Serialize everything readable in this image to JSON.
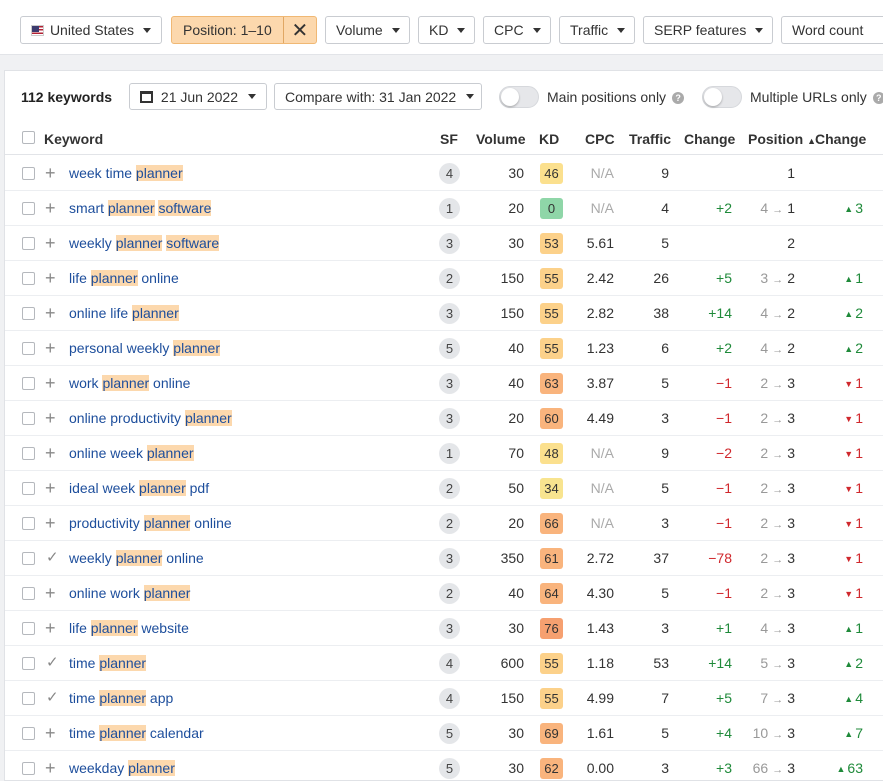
{
  "filters": {
    "country": "United States",
    "position": "Position: 1–10",
    "volume": "Volume",
    "kd": "KD",
    "cpc": "CPC",
    "traffic": "Traffic",
    "serp": "SERP features",
    "wordcount": "Word count"
  },
  "toolbar": {
    "count": "112 keywords",
    "date": "21 Jun 2022",
    "compare": "Compare with: 31 Jan 2022",
    "main_positions": "Main positions only",
    "multiple_urls": "Multiple URLs only"
  },
  "columns": {
    "keyword": "Keyword",
    "sf": "SF",
    "volume": "Volume",
    "kd": "KD",
    "cpc": "CPC",
    "traffic": "Traffic",
    "change": "Change",
    "position": "Position",
    "position_change": "Change"
  },
  "kd_colors": {
    "green": "#8fd6a8",
    "yellow": "#f8e48f",
    "yellowish": "#fbe08e",
    "lightorange": "#fcd18a",
    "orange": "#f9b47d",
    "orange2": "#f6a070"
  },
  "rows": [
    {
      "parts": [
        [
          "week time ",
          0
        ],
        [
          "planner",
          1
        ]
      ],
      "icon": "plus",
      "sf": "4",
      "volume": "30",
      "kd": "46",
      "cpc": "N/A",
      "traffic": "9",
      "change": "",
      "change_dir": "",
      "prev": "",
      "pos": "1",
      "pchange": "",
      "pdir": ""
    },
    {
      "parts": [
        [
          "smart ",
          0
        ],
        [
          "planner",
          1
        ],
        [
          " ",
          0
        ],
        [
          "software",
          1
        ]
      ],
      "icon": "plus",
      "sf": "1",
      "volume": "20",
      "kd": "0",
      "cpc": "N/A",
      "traffic": "4",
      "change": "+2",
      "change_dir": "up",
      "prev": "4",
      "pos": "1",
      "pchange": "3",
      "pdir": "up"
    },
    {
      "parts": [
        [
          "weekly ",
          0
        ],
        [
          "planner",
          1
        ],
        [
          " ",
          0
        ],
        [
          "software",
          1
        ]
      ],
      "icon": "plus",
      "sf": "3",
      "volume": "30",
      "kd": "53",
      "cpc": "5.61",
      "traffic": "5",
      "change": "",
      "change_dir": "",
      "prev": "",
      "pos": "2",
      "pchange": "",
      "pdir": ""
    },
    {
      "parts": [
        [
          "life ",
          0
        ],
        [
          "planner",
          1
        ],
        [
          " online",
          0
        ]
      ],
      "icon": "plus",
      "sf": "2",
      "volume": "150",
      "kd": "55",
      "cpc": "2.42",
      "traffic": "26",
      "change": "+5",
      "change_dir": "up",
      "prev": "3",
      "pos": "2",
      "pchange": "1",
      "pdir": "up"
    },
    {
      "parts": [
        [
          "online life ",
          0
        ],
        [
          "planner",
          1
        ]
      ],
      "icon": "plus",
      "sf": "3",
      "volume": "150",
      "kd": "55",
      "cpc": "2.82",
      "traffic": "38",
      "change": "+14",
      "change_dir": "up",
      "prev": "4",
      "pos": "2",
      "pchange": "2",
      "pdir": "up"
    },
    {
      "parts": [
        [
          "personal weekly ",
          0
        ],
        [
          "planner",
          1
        ]
      ],
      "icon": "plus",
      "sf": "5",
      "volume": "40",
      "kd": "55",
      "cpc": "1.23",
      "traffic": "6",
      "change": "+2",
      "change_dir": "up",
      "prev": "4",
      "pos": "2",
      "pchange": "2",
      "pdir": "up"
    },
    {
      "parts": [
        [
          "work ",
          0
        ],
        [
          "planner",
          1
        ],
        [
          " online",
          0
        ]
      ],
      "icon": "plus",
      "sf": "3",
      "volume": "40",
      "kd": "63",
      "cpc": "3.87",
      "traffic": "5",
      "change": "−1",
      "change_dir": "down",
      "prev": "2",
      "pos": "3",
      "pchange": "1",
      "pdir": "down"
    },
    {
      "parts": [
        [
          "online productivity ",
          0
        ],
        [
          "planner",
          1
        ]
      ],
      "icon": "plus",
      "sf": "3",
      "volume": "20",
      "kd": "60",
      "cpc": "4.49",
      "traffic": "3",
      "change": "−1",
      "change_dir": "down",
      "prev": "2",
      "pos": "3",
      "pchange": "1",
      "pdir": "down"
    },
    {
      "parts": [
        [
          "online week ",
          0
        ],
        [
          "planner",
          1
        ]
      ],
      "icon": "plus",
      "sf": "1",
      "volume": "70",
      "kd": "48",
      "cpc": "N/A",
      "traffic": "9",
      "change": "−2",
      "change_dir": "down",
      "prev": "2",
      "pos": "3",
      "pchange": "1",
      "pdir": "down"
    },
    {
      "parts": [
        [
          "ideal week ",
          0
        ],
        [
          "planner",
          1
        ],
        [
          " pdf",
          0
        ]
      ],
      "icon": "plus",
      "sf": "2",
      "volume": "50",
      "kd": "34",
      "cpc": "N/A",
      "traffic": "5",
      "change": "−1",
      "change_dir": "down",
      "prev": "2",
      "pos": "3",
      "pchange": "1",
      "pdir": "down"
    },
    {
      "parts": [
        [
          "productivity ",
          0
        ],
        [
          "planner",
          1
        ],
        [
          " online",
          0
        ]
      ],
      "icon": "plus",
      "sf": "2",
      "volume": "20",
      "kd": "66",
      "cpc": "N/A",
      "traffic": "3",
      "change": "−1",
      "change_dir": "down",
      "prev": "2",
      "pos": "3",
      "pchange": "1",
      "pdir": "down"
    },
    {
      "parts": [
        [
          "weekly ",
          0
        ],
        [
          "planner",
          1
        ],
        [
          " online",
          0
        ]
      ],
      "icon": "tick",
      "sf": "3",
      "volume": "350",
      "kd": "61",
      "cpc": "2.72",
      "traffic": "37",
      "change": "−78",
      "change_dir": "down",
      "prev": "2",
      "pos": "3",
      "pchange": "1",
      "pdir": "down"
    },
    {
      "parts": [
        [
          "online work ",
          0
        ],
        [
          "planner",
          1
        ]
      ],
      "icon": "plus",
      "sf": "2",
      "volume": "40",
      "kd": "64",
      "cpc": "4.30",
      "traffic": "5",
      "change": "−1",
      "change_dir": "down",
      "prev": "2",
      "pos": "3",
      "pchange": "1",
      "pdir": "down"
    },
    {
      "parts": [
        [
          "life ",
          0
        ],
        [
          "planner",
          1
        ],
        [
          " website",
          0
        ]
      ],
      "icon": "plus",
      "sf": "3",
      "volume": "30",
      "kd": "76",
      "cpc": "1.43",
      "traffic": "3",
      "change": "+1",
      "change_dir": "up",
      "prev": "4",
      "pos": "3",
      "pchange": "1",
      "pdir": "up"
    },
    {
      "parts": [
        [
          "time ",
          0
        ],
        [
          "planner",
          1
        ]
      ],
      "icon": "tick",
      "sf": "4",
      "volume": "600",
      "kd": "55",
      "cpc": "1.18",
      "traffic": "53",
      "change": "+14",
      "change_dir": "up",
      "prev": "5",
      "pos": "3",
      "pchange": "2",
      "pdir": "up"
    },
    {
      "parts": [
        [
          "time ",
          0
        ],
        [
          "planner",
          1
        ],
        [
          " app",
          0
        ]
      ],
      "icon": "tick",
      "sf": "4",
      "volume": "150",
      "kd": "55",
      "cpc": "4.99",
      "traffic": "7",
      "change": "+5",
      "change_dir": "up",
      "prev": "7",
      "pos": "3",
      "pchange": "4",
      "pdir": "up"
    },
    {
      "parts": [
        [
          "time ",
          0
        ],
        [
          "planner",
          1
        ],
        [
          " calendar",
          0
        ]
      ],
      "icon": "plus",
      "sf": "5",
      "volume": "30",
      "kd": "69",
      "cpc": "1.61",
      "traffic": "5",
      "change": "+4",
      "change_dir": "up",
      "prev": "10",
      "pos": "3",
      "pchange": "7",
      "pdir": "up"
    },
    {
      "parts": [
        [
          "weekday ",
          0
        ],
        [
          "planner",
          1
        ]
      ],
      "icon": "plus",
      "sf": "5",
      "volume": "30",
      "kd": "62",
      "cpc": "0.00",
      "traffic": "3",
      "change": "+3",
      "change_dir": "up",
      "prev": "66",
      "pos": "3",
      "pchange": "63",
      "pdir": "up"
    }
  ]
}
